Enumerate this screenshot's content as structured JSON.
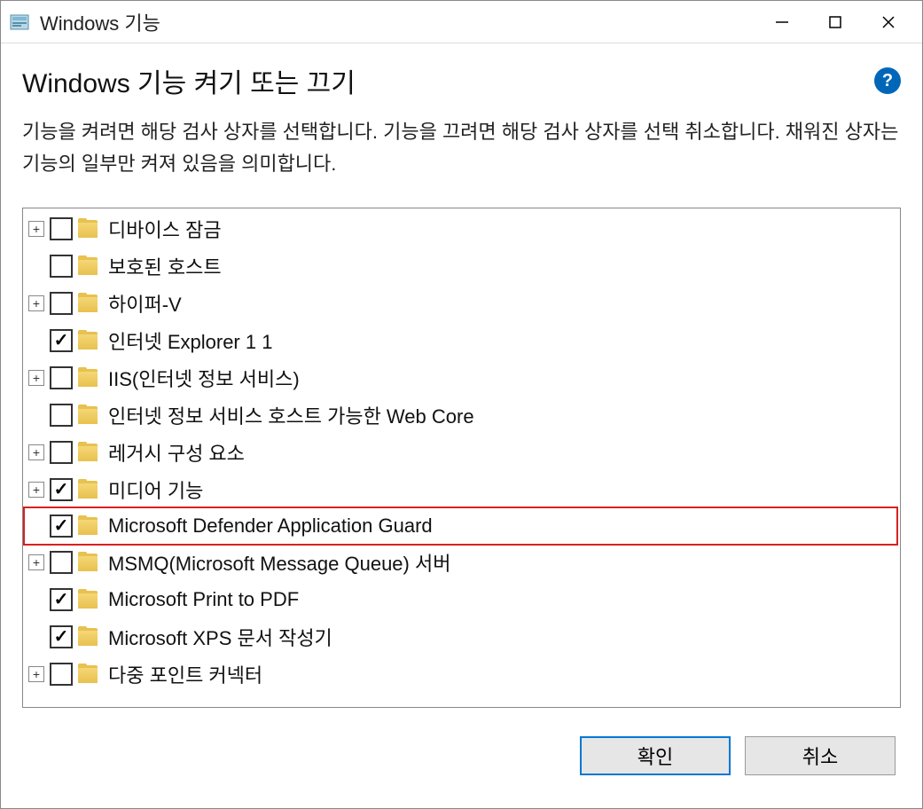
{
  "window": {
    "title": "Windows 기능"
  },
  "header": {
    "heading": "Windows 기능 켜기 또는 끄기",
    "description": "기능을 켜려면 해당 검사 상자를 선택합니다. 기능을 끄려면 해당 검사 상자를 선택 취소합니다. 채워진 상자는 기능의 일부만 켜져 있음을 의미합니다.",
    "help_tooltip": "?"
  },
  "features": [
    {
      "label": "디바이스 잠금",
      "checked": false,
      "expandable": true,
      "highlighted": false
    },
    {
      "label": "보호된 호스트",
      "checked": false,
      "expandable": false,
      "highlighted": false
    },
    {
      "label": "하이퍼-V",
      "checked": false,
      "expandable": true,
      "highlighted": false
    },
    {
      "label": "인터넷 Explorer 1 1",
      "checked": true,
      "expandable": false,
      "highlighted": false
    },
    {
      "label": "IIS(인터넷 정보 서비스)",
      "checked": false,
      "expandable": true,
      "highlighted": false
    },
    {
      "label": "인터넷 정보 서비스 호스트 가능한 Web Core",
      "checked": false,
      "expandable": false,
      "highlighted": false
    },
    {
      "label": "레거시 구성 요소",
      "checked": false,
      "expandable": true,
      "highlighted": false
    },
    {
      "label": "미디어 기능",
      "checked": true,
      "expandable": true,
      "highlighted": false
    },
    {
      "label": "Microsoft Defender Application Guard",
      "checked": true,
      "expandable": false,
      "highlighted": true
    },
    {
      "label": "MSMQ(Microsoft Message Queue) 서버",
      "checked": false,
      "expandable": true,
      "highlighted": false
    },
    {
      "label": "Microsoft Print to PDF",
      "checked": true,
      "expandable": false,
      "highlighted": false
    },
    {
      "label": "Microsoft XPS 문서 작성기",
      "checked": true,
      "expandable": false,
      "highlighted": false
    },
    {
      "label": "다중 포인트 커넥터",
      "checked": false,
      "expandable": true,
      "highlighted": false
    }
  ],
  "buttons": {
    "ok": "확인",
    "cancel": "취소"
  }
}
